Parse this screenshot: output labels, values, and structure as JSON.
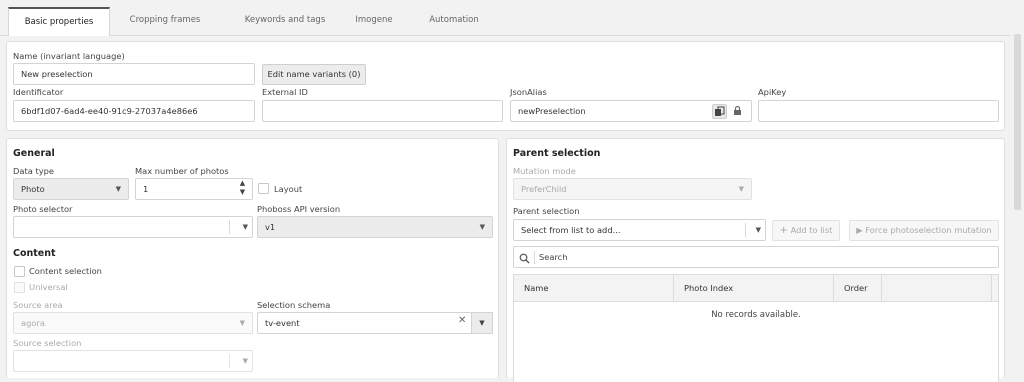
{
  "tabs": [
    {
      "label": "Basic properties",
      "active": true
    },
    {
      "label": "Cropping frames"
    },
    {
      "label": "Keywords and tags"
    },
    {
      "label": "Imogene"
    },
    {
      "label": "Automation"
    }
  ],
  "top": {
    "name_label": "Name (invariant language)",
    "name_value": "New preselection",
    "edit_variants_label": "Edit name variants (0)",
    "id_label": "Identificator",
    "id_value": "6bdf1d07-6ad4-ee40-91c9-27037a4e86e6",
    "external_id_label": "External ID",
    "external_id_value": "",
    "json_alias_label": "JsonAlias",
    "json_alias_value": "newPreselection",
    "api_key_label": "ApiKey",
    "api_key_value": ""
  },
  "general": {
    "heading": "General",
    "data_type_label": "Data type",
    "data_type_value": "Photo",
    "max_photos_label": "Max number of photos",
    "max_photos_value": "1",
    "layout_label": "Layout",
    "photo_selector_label": "Photo selector",
    "photo_selector_value": "",
    "api_version_label": "Phoboss API version",
    "api_version_value": "v1"
  },
  "content": {
    "heading": "Content",
    "content_selection_label": "Content selection",
    "universal_label": "Universal",
    "source_area_label": "Source area",
    "source_area_value": "agora",
    "selection_schema_label": "Selection schema",
    "selection_schema_value": "tv-event",
    "source_selection_label": "Source selection",
    "source_selection_value": ""
  },
  "parent": {
    "heading": "Parent selection",
    "mutation_mode_label": "Mutation mode",
    "mutation_mode_value": "PreferChild",
    "parent_selection_label": "Parent selection",
    "parent_selection_placeholder": "Select from list to add...",
    "add_to_list_label": "Add to list",
    "force_mutation_label": "Force photoselection mutation",
    "search_placeholder": "Search",
    "columns": [
      "Name",
      "Photo Index",
      "Order"
    ],
    "empty_text": "No records available."
  }
}
